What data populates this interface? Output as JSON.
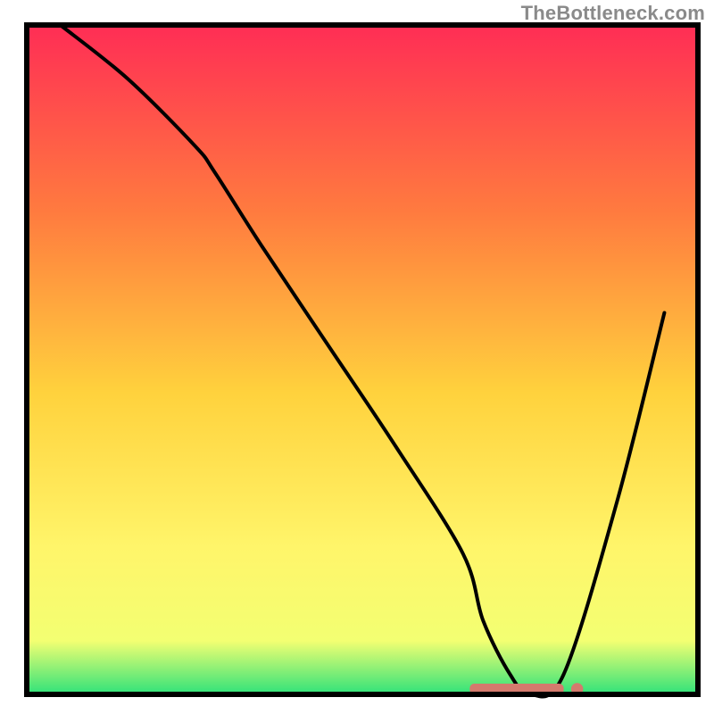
{
  "watermark": "TheBottleneck.com",
  "chart_data": {
    "type": "line",
    "title": "",
    "xlabel": "",
    "ylabel": "",
    "xlim": [
      0,
      100
    ],
    "ylim": [
      0,
      100
    ],
    "grid": false,
    "legend": false,
    "axes_visible": false,
    "background_gradient": {
      "top": "#ff2d55",
      "mid_upper": "#ff7b3f",
      "mid": "#ffd23d",
      "mid_lower": "#fff56a",
      "near_bottom": "#f3ff72",
      "bottom": "#2fe27a"
    },
    "series": [
      {
        "name": "bottleneck-curve",
        "color": "#000000",
        "x": [
          5,
          15,
          25,
          28,
          35,
          45,
          55,
          65,
          68,
          72,
          75,
          80,
          88,
          95
        ],
        "y": [
          100,
          92,
          82,
          78,
          67,
          52,
          37,
          21,
          11,
          3,
          0,
          3,
          29,
          57
        ]
      }
    ],
    "markers": [
      {
        "name": "optimal-range",
        "shape": "rounded-bar",
        "color": "#d47a6d",
        "x_start": 66,
        "x_end": 80,
        "y": 0.8,
        "height": 1.6
      },
      {
        "name": "optimal-dot",
        "shape": "dot",
        "color": "#d47a6d",
        "x": 82,
        "y": 0.8,
        "r": 0.9
      }
    ],
    "frame": {
      "stroke": "#000000",
      "stroke_width": 6
    }
  }
}
